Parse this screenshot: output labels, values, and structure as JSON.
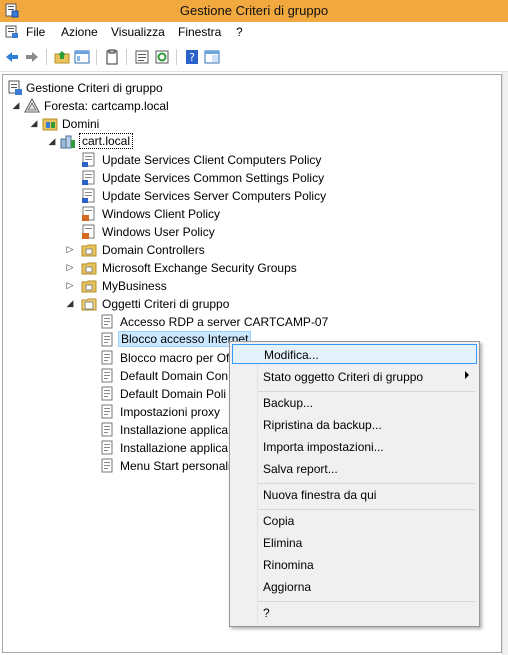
{
  "window": {
    "title": "Gestione Criteri di gruppo"
  },
  "menubar": {
    "items": [
      "File",
      "Azione",
      "Visualizza",
      "Finestra",
      "?"
    ]
  },
  "toolbar": {
    "icons": [
      "back-icon",
      "forward-icon",
      "up-folder-icon",
      "show-hide-tree-icon",
      "copy-icon",
      "properties-icon",
      "refresh-icon",
      "help-icon",
      "console-window-icon"
    ]
  },
  "tree": {
    "root": "Gestione Criteri di gruppo",
    "forest": "Foresta: cartcamp.local",
    "domains": "Domini",
    "domain": "cart.local",
    "items": [
      "Update Services Client Computers Policy",
      "Update Services Common Settings Policy",
      "Update Services Server Computers Policy",
      "Windows Client Policy",
      "Windows User Policy",
      "Domain Controllers",
      "Microsoft Exchange Security Groups",
      "MyBusiness",
      "Oggetti Criteri di gruppo"
    ],
    "gpo_items": [
      "Accesso RDP a server CARTCAMP-07",
      "Blocco accesso Internet",
      "Blocco macro per Of",
      "Default Domain Con",
      "Default Domain Poli",
      "Impostazioni proxy",
      "Installazione applica",
      "Installazione applica",
      "Menu Start personali"
    ]
  },
  "context_menu": {
    "items": [
      "Modifica...",
      "Stato oggetto Criteri di gruppo",
      "Backup...",
      "Ripristina da backup...",
      "Importa impostazioni...",
      "Salva report...",
      "Nuova finestra da qui",
      "Copia",
      "Elimina",
      "Rinomina",
      "Aggiorna",
      "?"
    ]
  },
  "colors": {
    "titlebar": "#f1a83f",
    "highlight_border": "#3399ff",
    "highlight_fill": "#e5f1fb",
    "selection": "#cce8ff"
  }
}
